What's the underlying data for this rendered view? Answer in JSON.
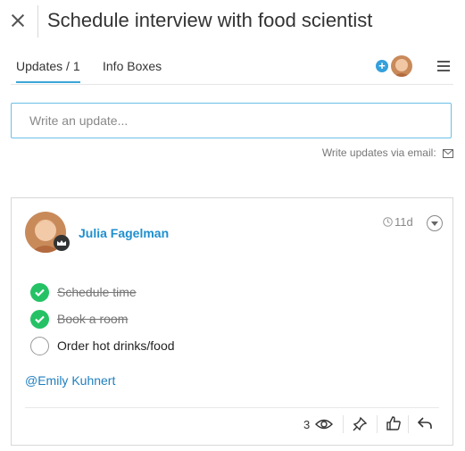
{
  "header": {
    "title": "Schedule interview with food scientist"
  },
  "tabs": [
    {
      "label": "Updates / 1",
      "active": true
    },
    {
      "label": "Info Boxes",
      "active": false
    }
  ],
  "update_box": {
    "placeholder": "Write an update..."
  },
  "email_hint": "Write updates via email:",
  "post": {
    "author": "Julia Fagelman",
    "time": "11d",
    "checklist": [
      {
        "text": "Schedule time",
        "done": true
      },
      {
        "text": "Book a room",
        "done": true
      },
      {
        "text": "Order hot drinks/food",
        "done": false
      }
    ],
    "mention": "@Emily Kuhnert",
    "views": "3"
  },
  "colors": {
    "accent": "#1f8fcf",
    "check": "#25c265",
    "input_border": "#6cc0e8"
  },
  "icons": [
    "close-icon",
    "plus-icon",
    "menu-icon",
    "mail-icon",
    "clock-icon",
    "chevron-down-icon",
    "eye-icon",
    "pin-icon",
    "thumbs-up-icon",
    "reply-icon",
    "crown-icon"
  ]
}
